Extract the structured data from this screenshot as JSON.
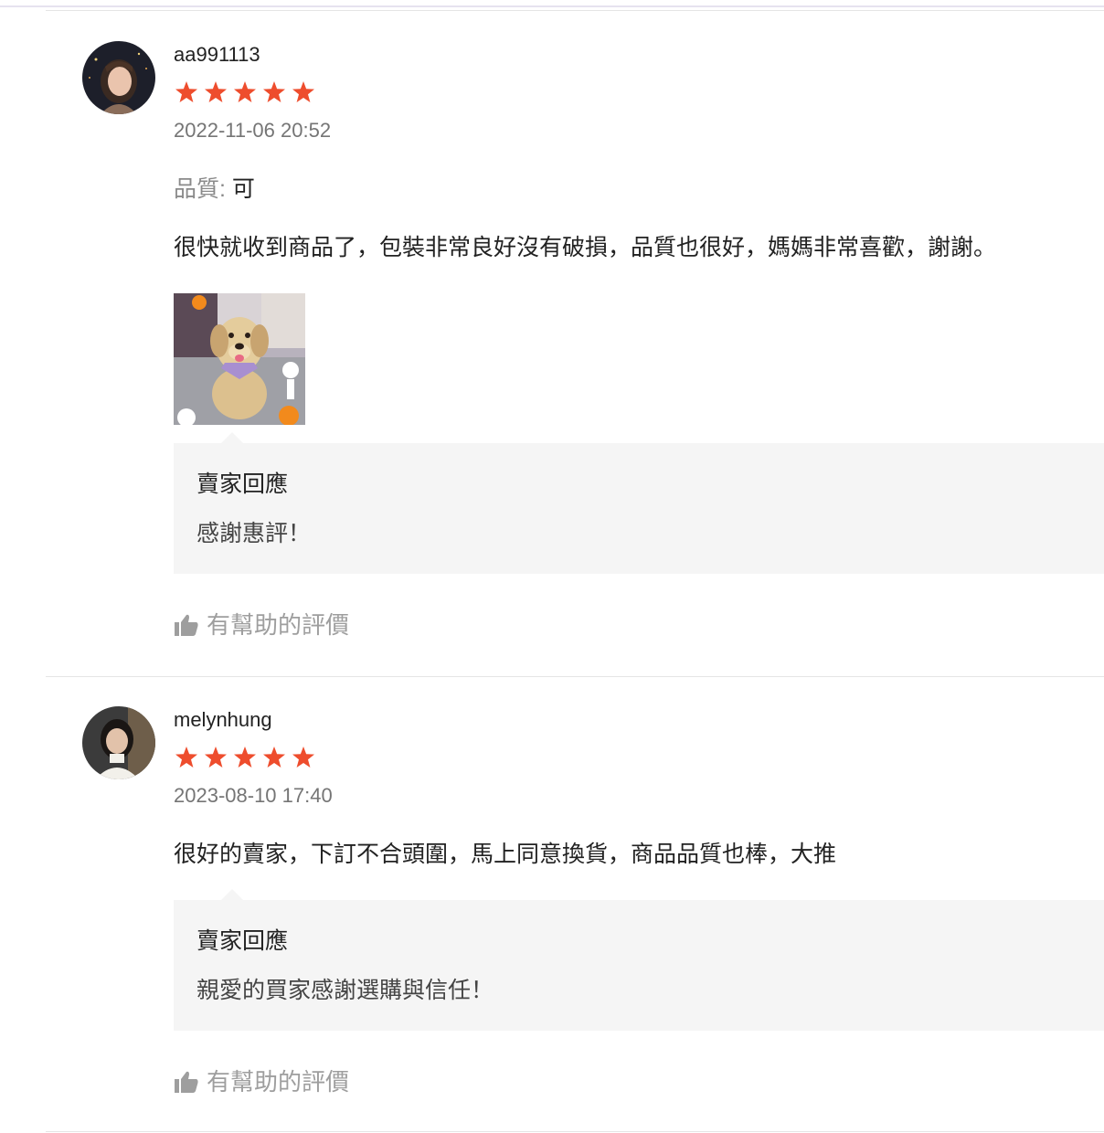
{
  "reviews": [
    {
      "username": "aa991113",
      "rating": 5,
      "date": "2022-11-06 20:52",
      "attribute_label": "品質:",
      "attribute_value": "可",
      "comment": "很快就收到商品了，包裝非常良好沒有破損，品質也很好，媽媽非常喜歡，謝謝。",
      "photo_icon": "dog-photo",
      "seller_reply_title": "賣家回應",
      "seller_reply_text": "感謝惠評！",
      "helpful_label": "有幫助的評價"
    },
    {
      "username": "melynhung",
      "rating": 5,
      "date": "2023-08-10 17:40",
      "comment": "很好的賣家，下訂不合頭圍，馬上同意換貨，商品品質也棒，大推",
      "seller_reply_title": "賣家回應",
      "seller_reply_text": "親愛的買家感謝選購與信任！",
      "helpful_label": "有幫助的評價"
    }
  ],
  "colors": {
    "star": "#ee4d2d",
    "muted_text": "#757575",
    "reply_background": "#f5f5f5",
    "divider": "#e5e5e5"
  },
  "icons": {
    "star": "star-icon",
    "helpful": "thumbs-up-icon"
  }
}
